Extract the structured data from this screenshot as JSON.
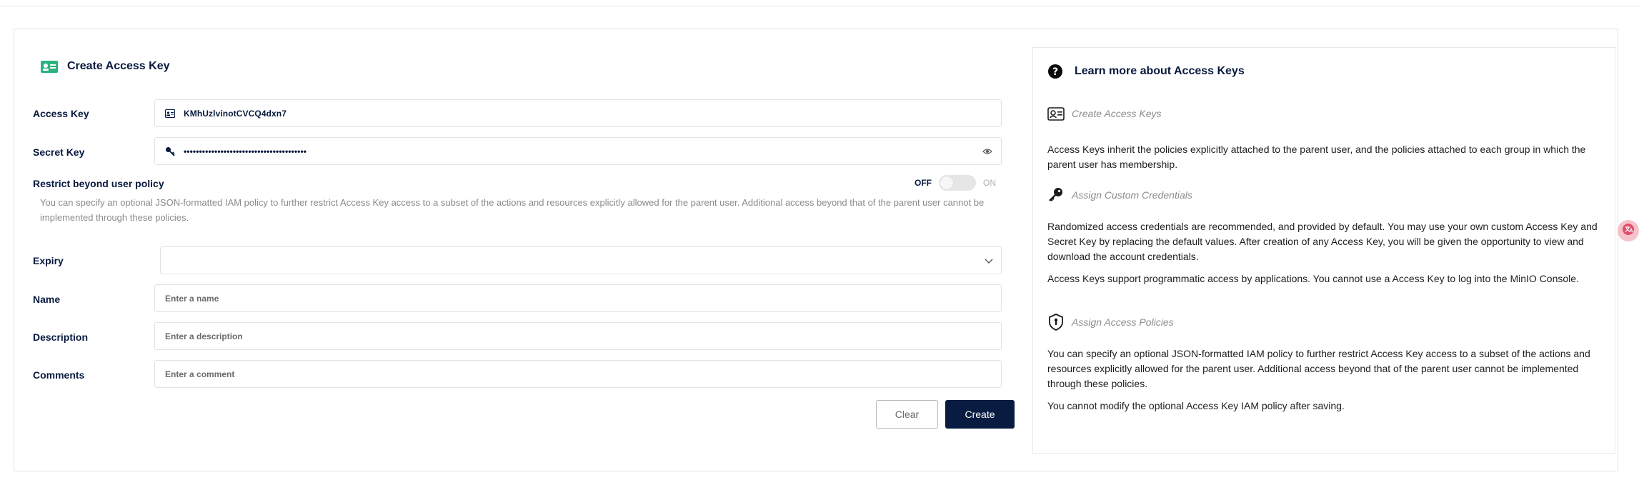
{
  "form": {
    "title": "Create Access Key",
    "access_key": {
      "label": "Access Key",
      "value": "KMhUzlvinotCVCQ4dxn7"
    },
    "secret_key": {
      "label": "Secret Key",
      "value": "••••••••••••••••••••••••••••••••••••••••"
    },
    "restrict": {
      "label": "Restrict beyond user policy",
      "toggle_off_label": "OFF",
      "toggle_on_label": "ON",
      "enabled": false,
      "help": "You can specify an optional JSON-formatted IAM policy to further restrict Access Key access to a subset of the actions and resources explicitly allowed for the parent user. Additional access beyond that of the parent user cannot be implemented through these policies."
    },
    "expiry": {
      "label": "Expiry",
      "value": ""
    },
    "name": {
      "label": "Name",
      "placeholder": "Enter a name"
    },
    "description": {
      "label": "Description",
      "placeholder": "Enter a description"
    },
    "comments": {
      "label": "Comments",
      "placeholder": "Enter a comment"
    },
    "clear_label": "Clear",
    "create_label": "Create"
  },
  "learn": {
    "title": "Learn more about Access Keys",
    "sections": [
      {
        "heading": "Create Access Keys",
        "icon": "id-card-icon",
        "paragraphs": [
          "Access Keys inherit the policies explicitly attached to the parent user, and the policies attached to each group in which the parent user has membership."
        ]
      },
      {
        "heading": "Assign Custom Credentials",
        "icon": "key-icon",
        "paragraphs": [
          "Randomized access credentials are recommended, and provided by default. You may use your own custom Access Key and Secret Key by replacing the default values. After creation of any Access Key, you will be given the opportunity to view and download the account credentials.",
          "Access Keys support programmatic access by applications. You cannot use a Access Key to log into the MinIO Console."
        ]
      },
      {
        "heading": "Assign Access Policies",
        "icon": "shield-icon",
        "paragraphs": [
          "You can specify an optional JSON-formatted IAM policy to further restrict Access Key access to a subset of the actions and resources explicitly allowed for the parent user. Additional access beyond that of the parent user cannot be implemented through these policies.",
          "You cannot modify the optional Access Key IAM policy after saving."
        ]
      }
    ]
  },
  "colors": {
    "primary": "#081c42",
    "accent": "#2bb37f",
    "badge": "#e04f6b"
  }
}
